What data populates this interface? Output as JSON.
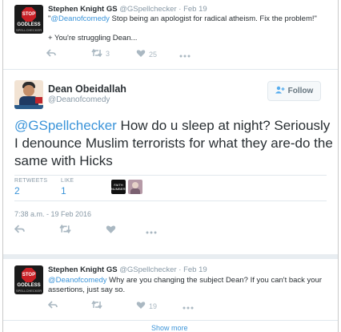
{
  "reply1": {
    "name": "Stephen Knight GS",
    "handle": "@GSpellchecker",
    "sep": "·",
    "date": "Feb 19",
    "avatar": {
      "stop": "STOP",
      "line1": "GODLESS",
      "line2": "SPELLCHECKER"
    },
    "mention": "@Deanofcomedy",
    "quote_open": "\"",
    "text": " Stop being an apologist for radical atheism. Fix the problem!\"",
    "line2": "+ You're struggling Dean...",
    "retweets": "3",
    "likes": "25"
  },
  "main": {
    "name": "Dean Obeidallah",
    "handle": "@Deanofcomedy",
    "follow_label": "Follow",
    "mention": "@GSpellchecker",
    "text": "  How do u sleep at night? Seriously I denounce Muslim terrorists for what they are-do the same with Hicks",
    "retweets_label": "RETWEETS",
    "retweets": "2",
    "likes_label": "LIKE",
    "likes": "1",
    "liker_text": "FAITH\nNUMBERS",
    "timestamp": "7:38 a.m. - 19 Feb 2016"
  },
  "reply2": {
    "name": "Stephen Knight GS",
    "handle": "@GSpellchecker",
    "sep": "·",
    "date": "Feb 19",
    "avatar": {
      "stop": "STOP",
      "line1": "GODLESS",
      "line2": "SPELLCHECKER"
    },
    "mention": "@Deanofcomedy",
    "text": " Why are you changing the subject Dean? If you can't back your assertions, just say so.",
    "likes": "19"
  },
  "show_more": "Show more",
  "icons": {
    "reply": "reply-icon",
    "retweet": "retweet-icon",
    "like": "heart-icon",
    "more": "more-icon",
    "follow": "add-user-icon"
  },
  "colors": {
    "link": "#3b94d9",
    "meta": "#8899a6",
    "icon": "#aab8c2",
    "stop": "#c91f25"
  }
}
